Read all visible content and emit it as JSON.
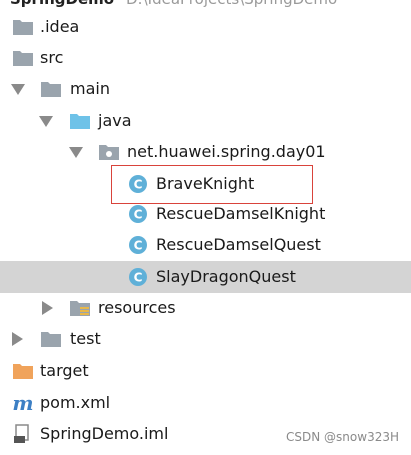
{
  "header": {
    "project_name": "SpringDemo",
    "project_path": "D:\\IdeaProjects\\SpringDemo"
  },
  "tree": {
    "idea": "idea",
    "idea_prefix": ".",
    "src": "src",
    "main": "main",
    "java": "java",
    "package": "net.huawei.spring.day01",
    "brave_knight": "BraveKnight",
    "rescue_knight": "RescueDamselKnight",
    "rescue_quest": "RescueDamselQuest",
    "slay_quest": "SlayDragonQuest",
    "resources": "resources",
    "test": "test",
    "target": "target",
    "pom": "pom.xml",
    "iml": "SpringDemo.iml"
  },
  "class_icon_letter": "C",
  "watermark": "CSDN @snow323H",
  "colors": {
    "folder_gray": "#9aa4ad",
    "folder_blue": "#6ec2e8",
    "folder_orange": "#f0a35b",
    "class_circle": "#5fb0d8",
    "selection": "#d4d4d4",
    "highlight_border": "#d9433b",
    "maven_blue": "#3c7fc4"
  }
}
